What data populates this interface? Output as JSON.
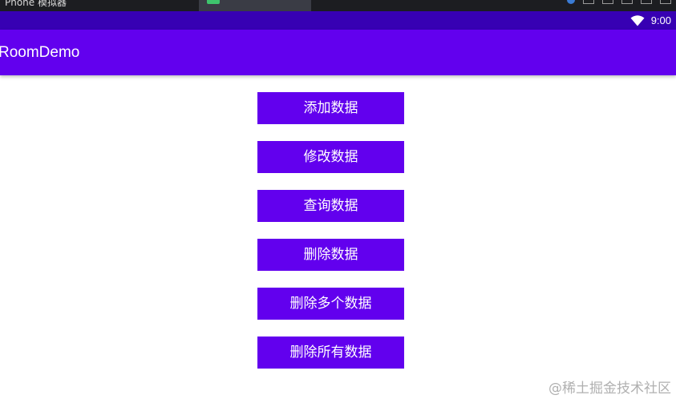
{
  "host": {
    "window_title": "Phone 模拟器"
  },
  "status_bar": {
    "time": "9:00",
    "wifi_icon": "wifi-icon"
  },
  "app_bar": {
    "title": "RoomDemo"
  },
  "buttons": {
    "add": "添加数据",
    "update": "修改数据",
    "query": "查询数据",
    "delete": "删除数据",
    "delete_multiple": "删除多个数据",
    "delete_all": "删除所有数据"
  },
  "watermark": "@稀土掘金技术社区",
  "colors": {
    "primary": "#6200ee",
    "primary_dark": "#3700b3",
    "on_primary": "#ffffff"
  }
}
